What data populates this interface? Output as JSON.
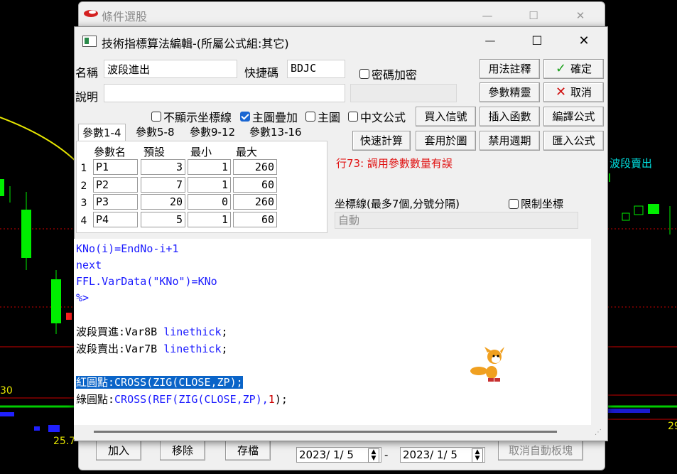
{
  "outer_window": {
    "title": "條件選股",
    "minimize": "—",
    "maximize": "☐",
    "close": "✕"
  },
  "dialog": {
    "title": "技術指標算法編輯-(所屬公式組:其它)",
    "minimize": "—",
    "maximize": "☐",
    "close": "✕"
  },
  "form": {
    "name_label": "名稱",
    "name_value": "波段進出",
    "shortcut_label": "快捷碼",
    "shortcut_value": "BDJC",
    "password_label": "密碼加密",
    "desc_label": "說明",
    "desc_value": "",
    "hide_axis_label": "不顯示坐標線",
    "overlay_main_label": "主圖疊加",
    "main_chart_label": "主圖",
    "chinese_formula_label": "中文公式",
    "error_message": "行73: 調用參數數量有誤",
    "axis_lines_label": "坐標線(最多7個,分號分隔)",
    "limit_axis_label": "限制坐標",
    "axis_value": "自動"
  },
  "buttons": {
    "usage_notes": "用法註釋",
    "ok": "確定",
    "param_wizard": "參數精靈",
    "cancel": "取消",
    "buy_sell_signal": "買入信號",
    "insert_function": "插入函數",
    "compile": "編譯公式",
    "quick_calc": "快速計算",
    "apply_chart": "套用於圖",
    "disable_period": "禁用週期",
    "import_formula": "匯入公式"
  },
  "tabs": [
    "參數1-4",
    "參數5-8",
    "參數9-12",
    "參數13-16"
  ],
  "param_table": {
    "headers": [
      "參數名",
      "預設",
      "最小",
      "最大"
    ],
    "rows": [
      {
        "n": "1",
        "name": "P1",
        "def": "3",
        "min": "1",
        "max": "260"
      },
      {
        "n": "2",
        "name": "P2",
        "def": "7",
        "min": "1",
        "max": "60"
      },
      {
        "n": "3",
        "name": "P3",
        "def": "20",
        "min": "0",
        "max": "260"
      },
      {
        "n": "4",
        "name": "P4",
        "def": "5",
        "min": "1",
        "max": "60"
      }
    ]
  },
  "code": {
    "l1": "KNo(i)=EndNo-i+1",
    "l2": "next",
    "l3": "FFL.VarData(\"KNo\")=KNo",
    "l4": "%>",
    "l5a": "波段買進:Var8B ",
    "l5b": "linethick",
    "l5c": ";",
    "l6a": "波段賣出:Var7B ",
    "l6b": "linethick",
    "l6c": ";",
    "l7": "紅圓點:CROSS(ZIG(CLOSE,ZP);",
    "l8a": "綠圓點:",
    "l8b": "CROSS(REF(ZIG(CLOSE,ZP),",
    "l8c": "1",
    "l8d": ");"
  },
  "bottom_bar": {
    "add": "加入",
    "remove": "移除",
    "save": "存檔",
    "date_from": "2023/ 1/ 5",
    "date_sep": "-",
    "date_to": "2023/ 1/ 5",
    "cancel_auto": "取消自動板塊"
  },
  "background_chart": {
    "label_sell": "波段賣出",
    "label_30": "30",
    "label_257": "25.7",
    "label_29": "29"
  }
}
